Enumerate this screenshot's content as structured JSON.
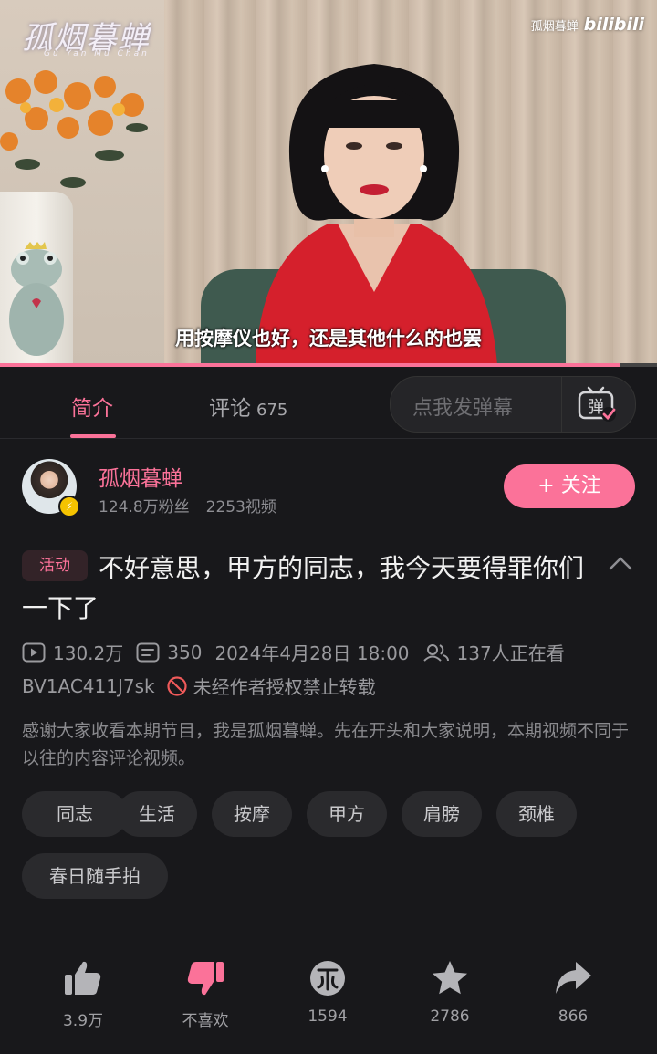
{
  "video": {
    "logo_text": "孤烟暮蝉",
    "logo_sub": "Gu Yan Mu Chan",
    "watermark_name": "孤烟暮蝉",
    "watermark_brand": "bilibili",
    "subtitle": "用按摩仪也好，还是其他什么的也罢",
    "progress": 0.943
  },
  "tabs": {
    "intro": "简介",
    "comments": "评论",
    "comments_count": "675",
    "danmaku_placeholder": "点我发弹幕",
    "danmaku_icon_char": "弹"
  },
  "uploader": {
    "name": "孤烟暮蝉",
    "fans": "124.8万粉丝",
    "videos": "2253视频",
    "follow_label": "+ 关注"
  },
  "video_info": {
    "activity_tag": "活动",
    "title": "不好意思，甲方的同志，我今天要得罪你们一下了",
    "views": "130.2万",
    "danmaku_count": "350",
    "datetime": "2024年4月28日 18:00",
    "watching": "137人正在看",
    "bvid": "BV1AC411J7sk",
    "copyright": "未经作者授权禁止转载",
    "description": "感谢大家收看本期节目，我是孤烟暮蝉。先在开头和大家说明，本期视频不同于以往的内容评论视频。"
  },
  "tags": [
    "同志",
    "生活",
    "按摩",
    "甲方",
    "肩膀",
    "颈椎",
    "春日随手拍"
  ],
  "actions": {
    "like": "3.9万",
    "dislike": "不喜欢",
    "coin": "1594",
    "favorite": "2786",
    "share": "866"
  },
  "colors": {
    "accent": "#fb7299",
    "background": "#18181b"
  }
}
